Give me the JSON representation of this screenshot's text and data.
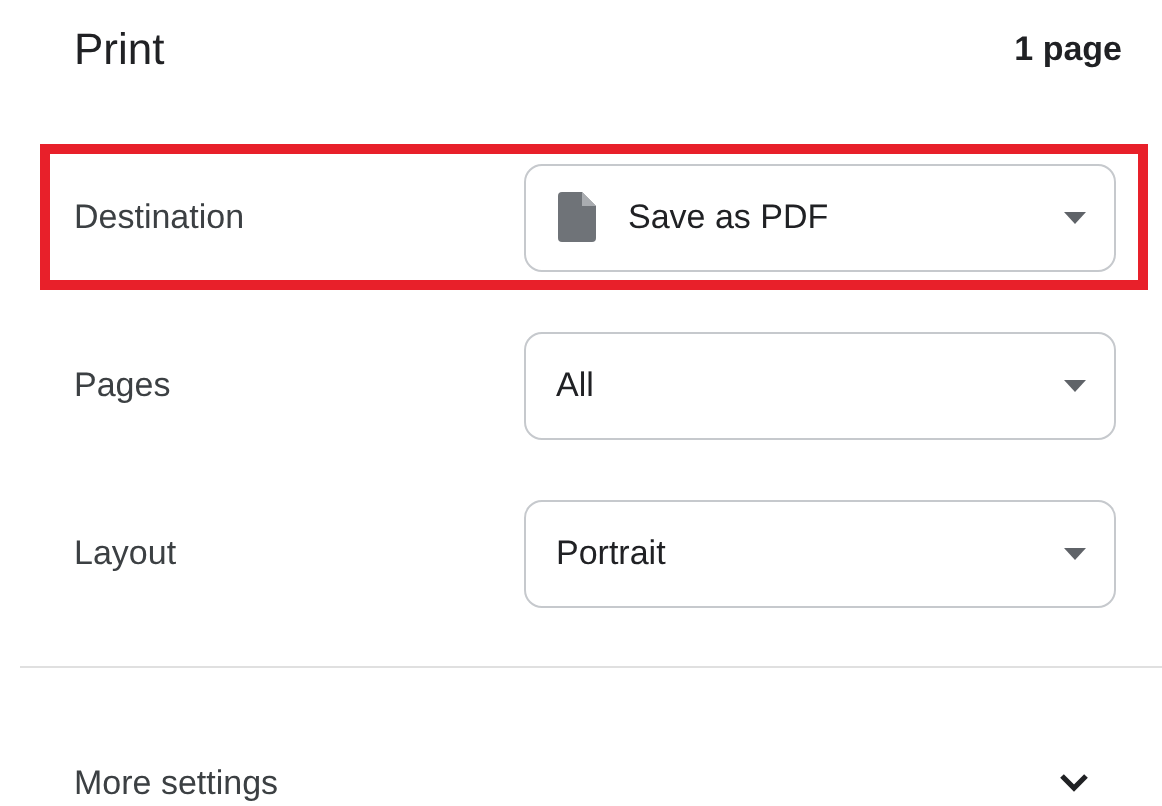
{
  "header": {
    "title": "Print",
    "page_count": "1 page"
  },
  "settings": [
    {
      "label": "Destination",
      "value": "Save as PDF",
      "kind": "file",
      "highlighted": true
    },
    {
      "label": "Pages",
      "value": "All",
      "kind": "plain",
      "highlighted": false
    },
    {
      "label": "Layout",
      "value": "Portrait",
      "kind": "plain",
      "highlighted": false
    }
  ],
  "more_settings": {
    "label": "More settings",
    "expanded": false
  }
}
